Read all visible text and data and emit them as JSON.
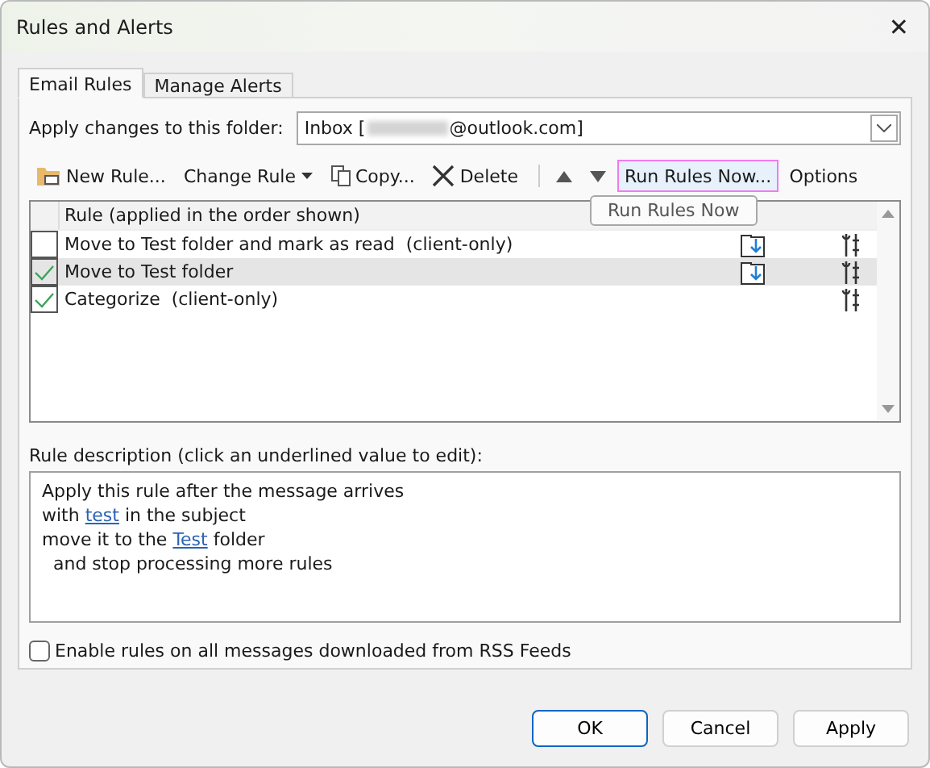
{
  "window": {
    "title": "Rules and Alerts",
    "close": "✕"
  },
  "tabs": [
    {
      "label": "Email Rules",
      "selected": true
    },
    {
      "label": "Manage Alerts",
      "selected": false
    }
  ],
  "folder": {
    "label": "Apply changes to this folder:",
    "value_start": "Inbox [",
    "value_end": "@outlook.com]",
    "redacted": true
  },
  "toolbar": [
    {
      "kind": "new",
      "label": "New Rule..."
    },
    {
      "kind": "change",
      "label": "Change Rule"
    },
    {
      "kind": "copy",
      "label": "Copy..."
    },
    {
      "kind": "delete",
      "label": "Delete"
    },
    {
      "kind": "up"
    },
    {
      "kind": "down"
    },
    {
      "kind": "run",
      "label": "Run Rules Now...",
      "highlighted": true
    },
    {
      "kind": "options",
      "label": "Options"
    }
  ],
  "tooltip": "Run Rules Now",
  "rules": {
    "column": "Rule (applied in the order shown)",
    "rows": [
      {
        "name": "Move to Test folder and mark as read  (client-only)",
        "checked": false,
        "selected": false,
        "kind": "move"
      },
      {
        "name": "Move to Test folder",
        "checked": true,
        "selected": true,
        "kind": "move"
      },
      {
        "name": "Categorize  (client-only)",
        "checked": true,
        "selected": false,
        "kind": "plain"
      }
    ]
  },
  "description": {
    "label": "Rule description (click an underlined value to edit):",
    "lines": [
      [
        {
          "text": "Apply this rule after the message arrives"
        }
      ],
      [
        {
          "text": "with "
        },
        {
          "text": "test",
          "link": true
        },
        {
          "text": " in the subject"
        }
      ],
      [
        {
          "text": "move it to the "
        },
        {
          "text": "Test",
          "link": true
        },
        {
          "text": " folder"
        }
      ],
      [
        {
          "text": "  and stop processing more rules"
        }
      ]
    ]
  },
  "rss": {
    "label": "Enable rules on all messages downloaded from RSS Feeds",
    "checked": false
  },
  "buttons": [
    {
      "label": "OK",
      "default": true
    },
    {
      "label": "Cancel",
      "default": false
    },
    {
      "label": "Apply",
      "default": false
    }
  ]
}
